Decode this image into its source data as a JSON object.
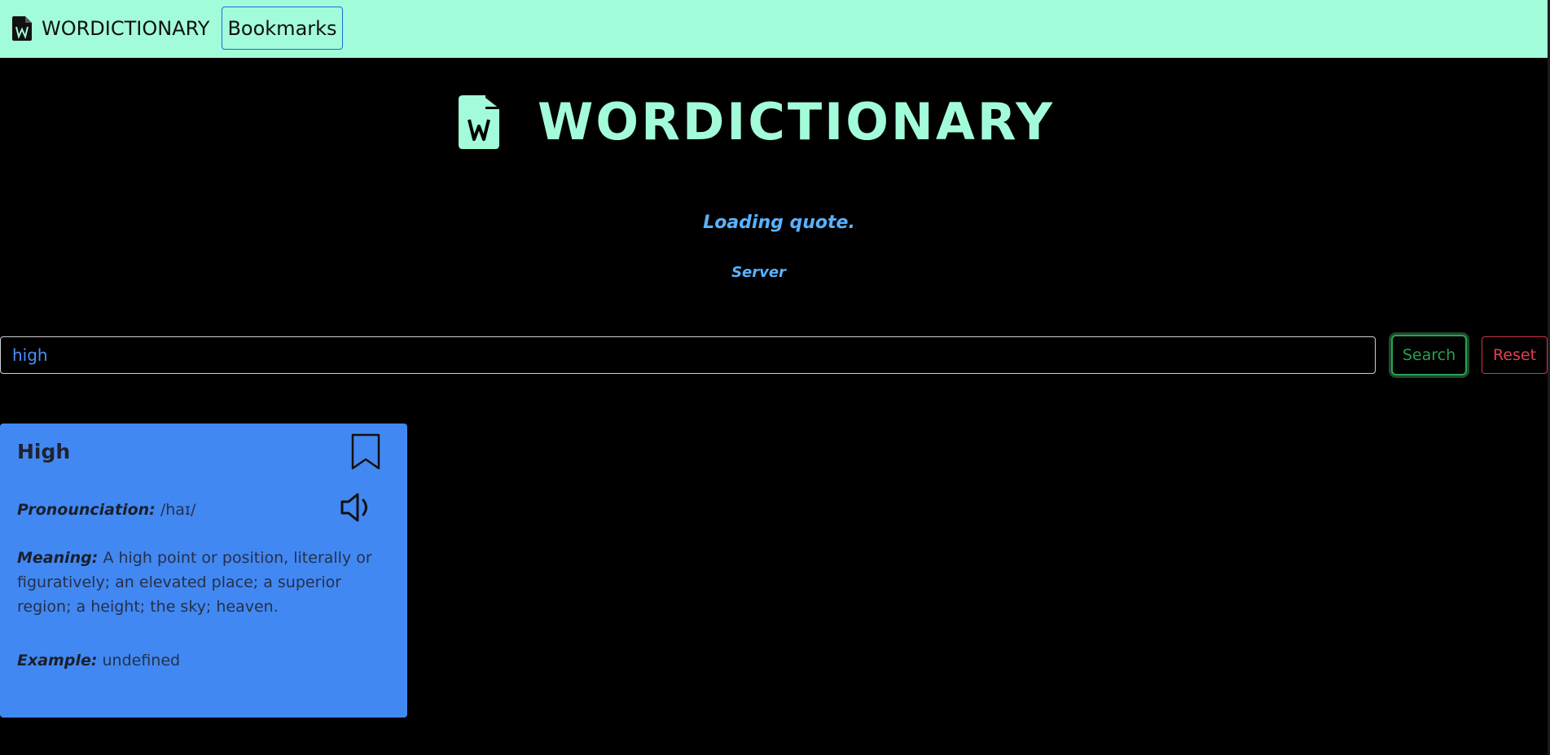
{
  "navbar": {
    "brand": "WORDICTIONARY",
    "bookmarks_label": "Bookmarks",
    "background": "#a3fcd9"
  },
  "hero": {
    "title": "WORDICTIONARY",
    "icon": "word-file-icon",
    "color": "#a3fcd9"
  },
  "quote": {
    "text": "Loading quote.",
    "author": "Server",
    "color": "#5ab2ff"
  },
  "search": {
    "value": "high",
    "search_label": "Search",
    "reset_label": "Reset"
  },
  "result": {
    "word": "High",
    "pron_label": "Pronounciation:",
    "pron": "/haɪ/",
    "meaning_label": "Meaning:",
    "meaning": "A high point or position, literally or figuratively; an elevated place; a superior region; a height; the sky; heaven.",
    "example_label": "Example:",
    "example": "undefined",
    "card_color": "#4288f2",
    "icons": [
      "bookmark-icon",
      "speaker-icon"
    ]
  }
}
